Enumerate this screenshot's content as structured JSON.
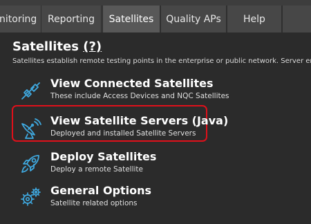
{
  "tabs": [
    {
      "label": "nitoring",
      "active": false
    },
    {
      "label": "Reporting",
      "active": false
    },
    {
      "label": "Satellites",
      "active": true
    },
    {
      "label": "Quality APs",
      "active": false
    },
    {
      "label": "Help",
      "active": false
    }
  ],
  "page": {
    "title": "Satellites",
    "help_link": "(?)",
    "description": "Satellites establish remote testing points in the enterprise or public network. Server enab"
  },
  "items": [
    {
      "title": "View Connected Satellites",
      "subtitle": "These include Access Devices and NQC Satellites",
      "icon": "connection-plug-icon"
    },
    {
      "title": "View Satellite Servers (Java)",
      "subtitle": "Deployed and installed Satellite Servers",
      "icon": "satellite-dish-icon",
      "highlighted": true
    },
    {
      "title": "Deploy Satellites",
      "subtitle": "Deploy a remote Satellite",
      "icon": "rocket-icon"
    },
    {
      "title": "General Options",
      "subtitle": "Satellite related options",
      "icon": "gears-icon"
    }
  ],
  "colors": {
    "accent_icon": "#3fa9e0",
    "highlight_border": "#e0101a",
    "background": "#2b2b2b",
    "tabbar": "#3d3d3d"
  }
}
